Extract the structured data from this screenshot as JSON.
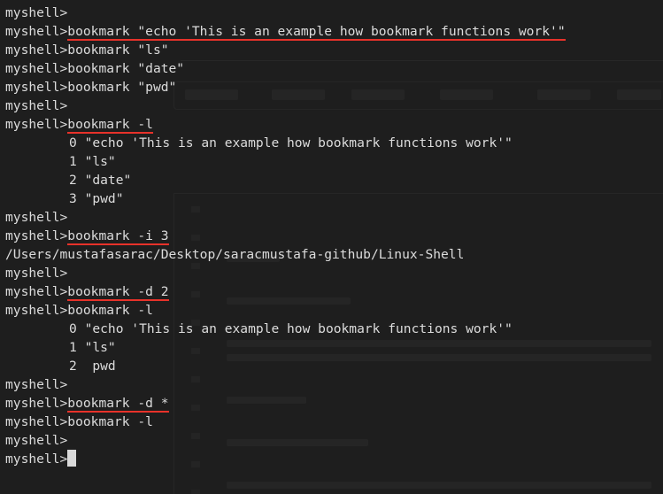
{
  "terminal": {
    "prompt": "myshell>",
    "lines": [
      {
        "type": "prompt",
        "cmd": ""
      },
      {
        "type": "prompt",
        "cmd": "bookmark \"echo 'This is an example how bookmark functions work'\"",
        "marked": true
      },
      {
        "type": "prompt",
        "cmd": "bookmark \"ls\""
      },
      {
        "type": "prompt",
        "cmd": "bookmark \"date\""
      },
      {
        "type": "prompt",
        "cmd": "bookmark \"pwd\""
      },
      {
        "type": "prompt",
        "cmd": ""
      },
      {
        "type": "prompt",
        "cmd": "bookmark -l",
        "marked": true
      },
      {
        "type": "output",
        "text": "0 \"echo 'This is an example how bookmark functions work'\"",
        "indent": true
      },
      {
        "type": "output",
        "text": "1 \"ls\"",
        "indent": true
      },
      {
        "type": "output",
        "text": "2 \"date\"",
        "indent": true
      },
      {
        "type": "output",
        "text": "3 \"pwd\"",
        "indent": true
      },
      {
        "type": "prompt",
        "cmd": ""
      },
      {
        "type": "prompt",
        "cmd": "bookmark -i 3",
        "marked": true
      },
      {
        "type": "output",
        "text": "/Users/mustafasarac/Desktop/saracmustafa-github/Linux-Shell",
        "indent": false
      },
      {
        "type": "prompt",
        "cmd": ""
      },
      {
        "type": "prompt",
        "cmd": "bookmark -d 2",
        "marked": true
      },
      {
        "type": "prompt",
        "cmd": "bookmark -l"
      },
      {
        "type": "output",
        "text": "0 \"echo 'This is an example how bookmark functions work'\"",
        "indent": true
      },
      {
        "type": "output",
        "text": "1 \"ls\"",
        "indent": true
      },
      {
        "type": "output",
        "text": "2  pwd",
        "indent": true
      },
      {
        "type": "prompt",
        "cmd": ""
      },
      {
        "type": "prompt",
        "cmd": "bookmark -d *",
        "marked": true
      },
      {
        "type": "prompt",
        "cmd": "bookmark -l"
      },
      {
        "type": "prompt",
        "cmd": ""
      },
      {
        "type": "prompt",
        "cmd": "",
        "cursor": true
      }
    ]
  },
  "colors": {
    "background": "#1e1e1e",
    "text": "#dcdcdc",
    "underline": "#e8322a",
    "cursor": "#d9d9d9"
  }
}
